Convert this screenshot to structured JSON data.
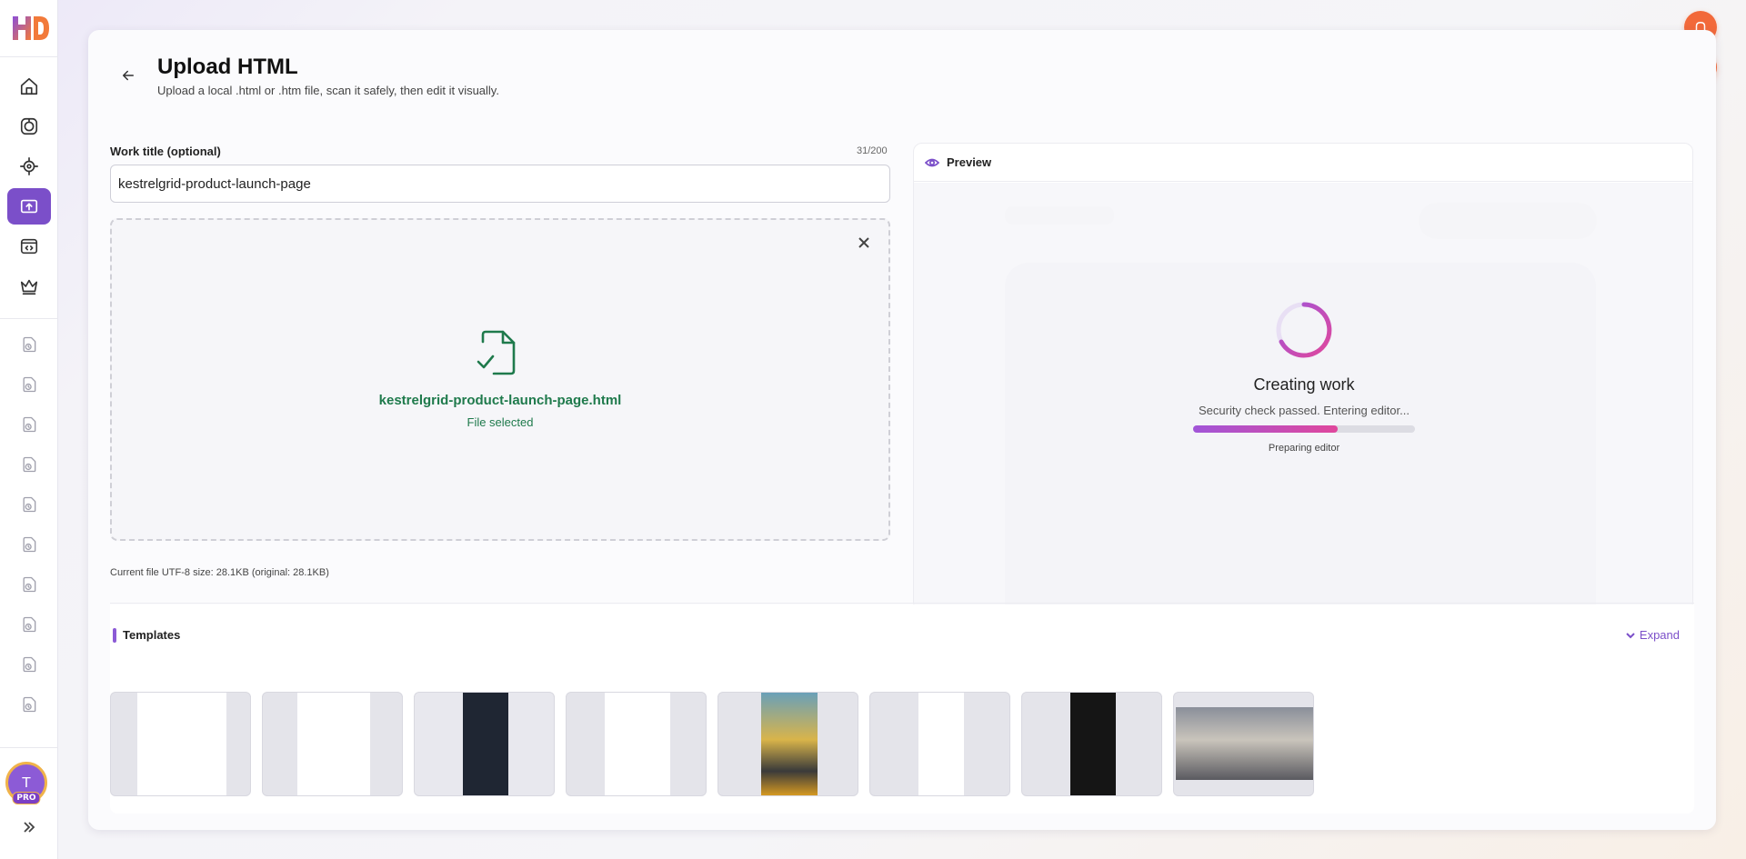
{
  "sidebar": {
    "logo_text": "HD",
    "nav_items": [
      {
        "name": "home",
        "icon": "home-icon"
      },
      {
        "name": "camera",
        "icon": "camera-icon"
      },
      {
        "name": "target",
        "icon": "crosshair-icon"
      },
      {
        "name": "upload",
        "icon": "upload-icon",
        "active": true
      },
      {
        "name": "code",
        "icon": "code-window-icon"
      },
      {
        "name": "premium",
        "icon": "crown-icon"
      }
    ],
    "history_count": 10,
    "avatar_initial": "T",
    "avatar_badge": "PRO"
  },
  "header": {
    "title": "Upload HTML",
    "subtitle": "Upload a local .html or .htm file, scan it safely, then edit it visually."
  },
  "form": {
    "title_label": "Work title (optional)",
    "title_count": "31/200",
    "title_value": "kestrelgrid-product-launch-page",
    "file_name": "kestrelgrid-product-launch-page.html",
    "file_status": "File selected",
    "file_size": "Current file UTF-8 size: 28.1KB (original: 28.1KB)"
  },
  "preview": {
    "title": "Preview",
    "status_title": "Creating work",
    "status_message": "Security check passed. Entering editor...",
    "progress_label": "Preparing editor",
    "progress": 0.65
  },
  "templates": {
    "title": "Templates",
    "expand_label": "Expand",
    "items": [
      {
        "name": "template-1"
      },
      {
        "name": "template-2"
      },
      {
        "name": "template-3"
      },
      {
        "name": "template-4"
      },
      {
        "name": "template-5"
      },
      {
        "name": "template-6"
      },
      {
        "name": "template-7"
      },
      {
        "name": "template-8"
      }
    ]
  },
  "colors": {
    "accent": "#7b4fc9",
    "success": "#1f7a4c",
    "fab": "#f2693a"
  }
}
